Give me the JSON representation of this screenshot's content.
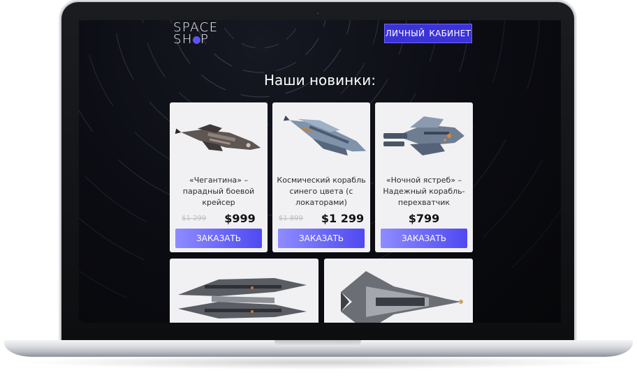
{
  "header": {
    "logo_line1": "SPACE",
    "logo_line2_a": "SH",
    "logo_line2_b": "P",
    "cabinet_word1": "ЛИЧНЫЙ",
    "cabinet_word2": "КАБИНЕТ"
  },
  "main": {
    "title": "Наши новинки:",
    "products": [
      {
        "name": "«Чегантина» – парадный боевой крейсер",
        "old_price": "$1 299",
        "price": "$999",
        "order_label": "ЗАКАЗАТЬ",
        "icon": "cruiser-ship-image"
      },
      {
        "name": "Космический корабль синего цвета (с локаторами)",
        "old_price": "$1 899",
        "price": "$1 299",
        "order_label": "ЗАКАЗАТЬ",
        "icon": "blue-ship-image"
      },
      {
        "name": "«Ночной ястреб» – Надежный корабль-перехватчик",
        "old_price": "",
        "price": "$799",
        "order_label": "ЗАКАЗАТЬ",
        "icon": "interceptor-ship-image"
      },
      {
        "icon": "twin-blade-ship-image"
      },
      {
        "icon": "delta-fighter-image"
      }
    ]
  },
  "colors": {
    "accent": "#3b33d6",
    "button_gradient_start": "#8e8cff",
    "button_gradient_end": "#4f49f2",
    "card_bg": "#f1f1f3",
    "logo_dot": "#5a54f4"
  }
}
